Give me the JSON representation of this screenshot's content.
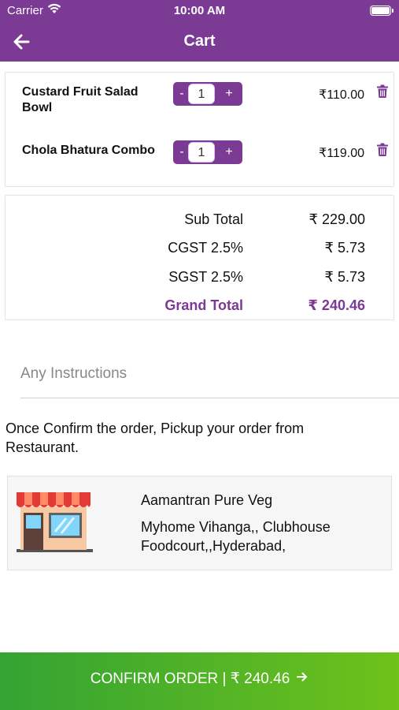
{
  "status_bar": {
    "carrier": "Carrier",
    "time": "10:00 AM",
    "wifi_icon": "wifi-icon",
    "battery_icon": "battery-icon"
  },
  "nav": {
    "title": "Cart",
    "back_icon": "arrow-left-icon"
  },
  "cart": {
    "items": [
      {
        "name": "Custard Fruit Salad Bowl",
        "quantity": "1",
        "minus_label": "-",
        "plus_label": "+",
        "price": "₹110.00",
        "delete_icon": "trash-icon"
      },
      {
        "name": "Chola Bhatura Combo",
        "quantity": "1",
        "minus_label": "-",
        "plus_label": "+",
        "price": "₹119.00",
        "delete_icon": "trash-icon"
      }
    ]
  },
  "totals": {
    "rows": [
      {
        "label": "Sub Total",
        "value": "₹ 229.00"
      },
      {
        "label": "CGST 2.5%",
        "value": "₹ 5.73"
      },
      {
        "label": "SGST 2.5%",
        "value": "₹ 5.73"
      }
    ],
    "grand": {
      "label": "Grand Total",
      "value": "₹ 240.46"
    }
  },
  "instructions": {
    "placeholder": "Any Instructions",
    "value": ""
  },
  "pickup_note": "Once Confirm the order, Pickup your order from Restaurant.",
  "restaurant": {
    "name": "Aamantran Pure Veg",
    "address": "Myhome Vihanga,, Clubhouse Foodcourt,,Hyderabad,",
    "icon": "storefront-icon"
  },
  "confirm": {
    "label": "CONFIRM ORDER | ₹ 240.46",
    "arrow_icon": "arrow-right-icon"
  },
  "colors": {
    "brand_purple": "#7b3a94",
    "confirm_green_start": "#33a333",
    "confirm_green_end": "#6ec21a"
  }
}
